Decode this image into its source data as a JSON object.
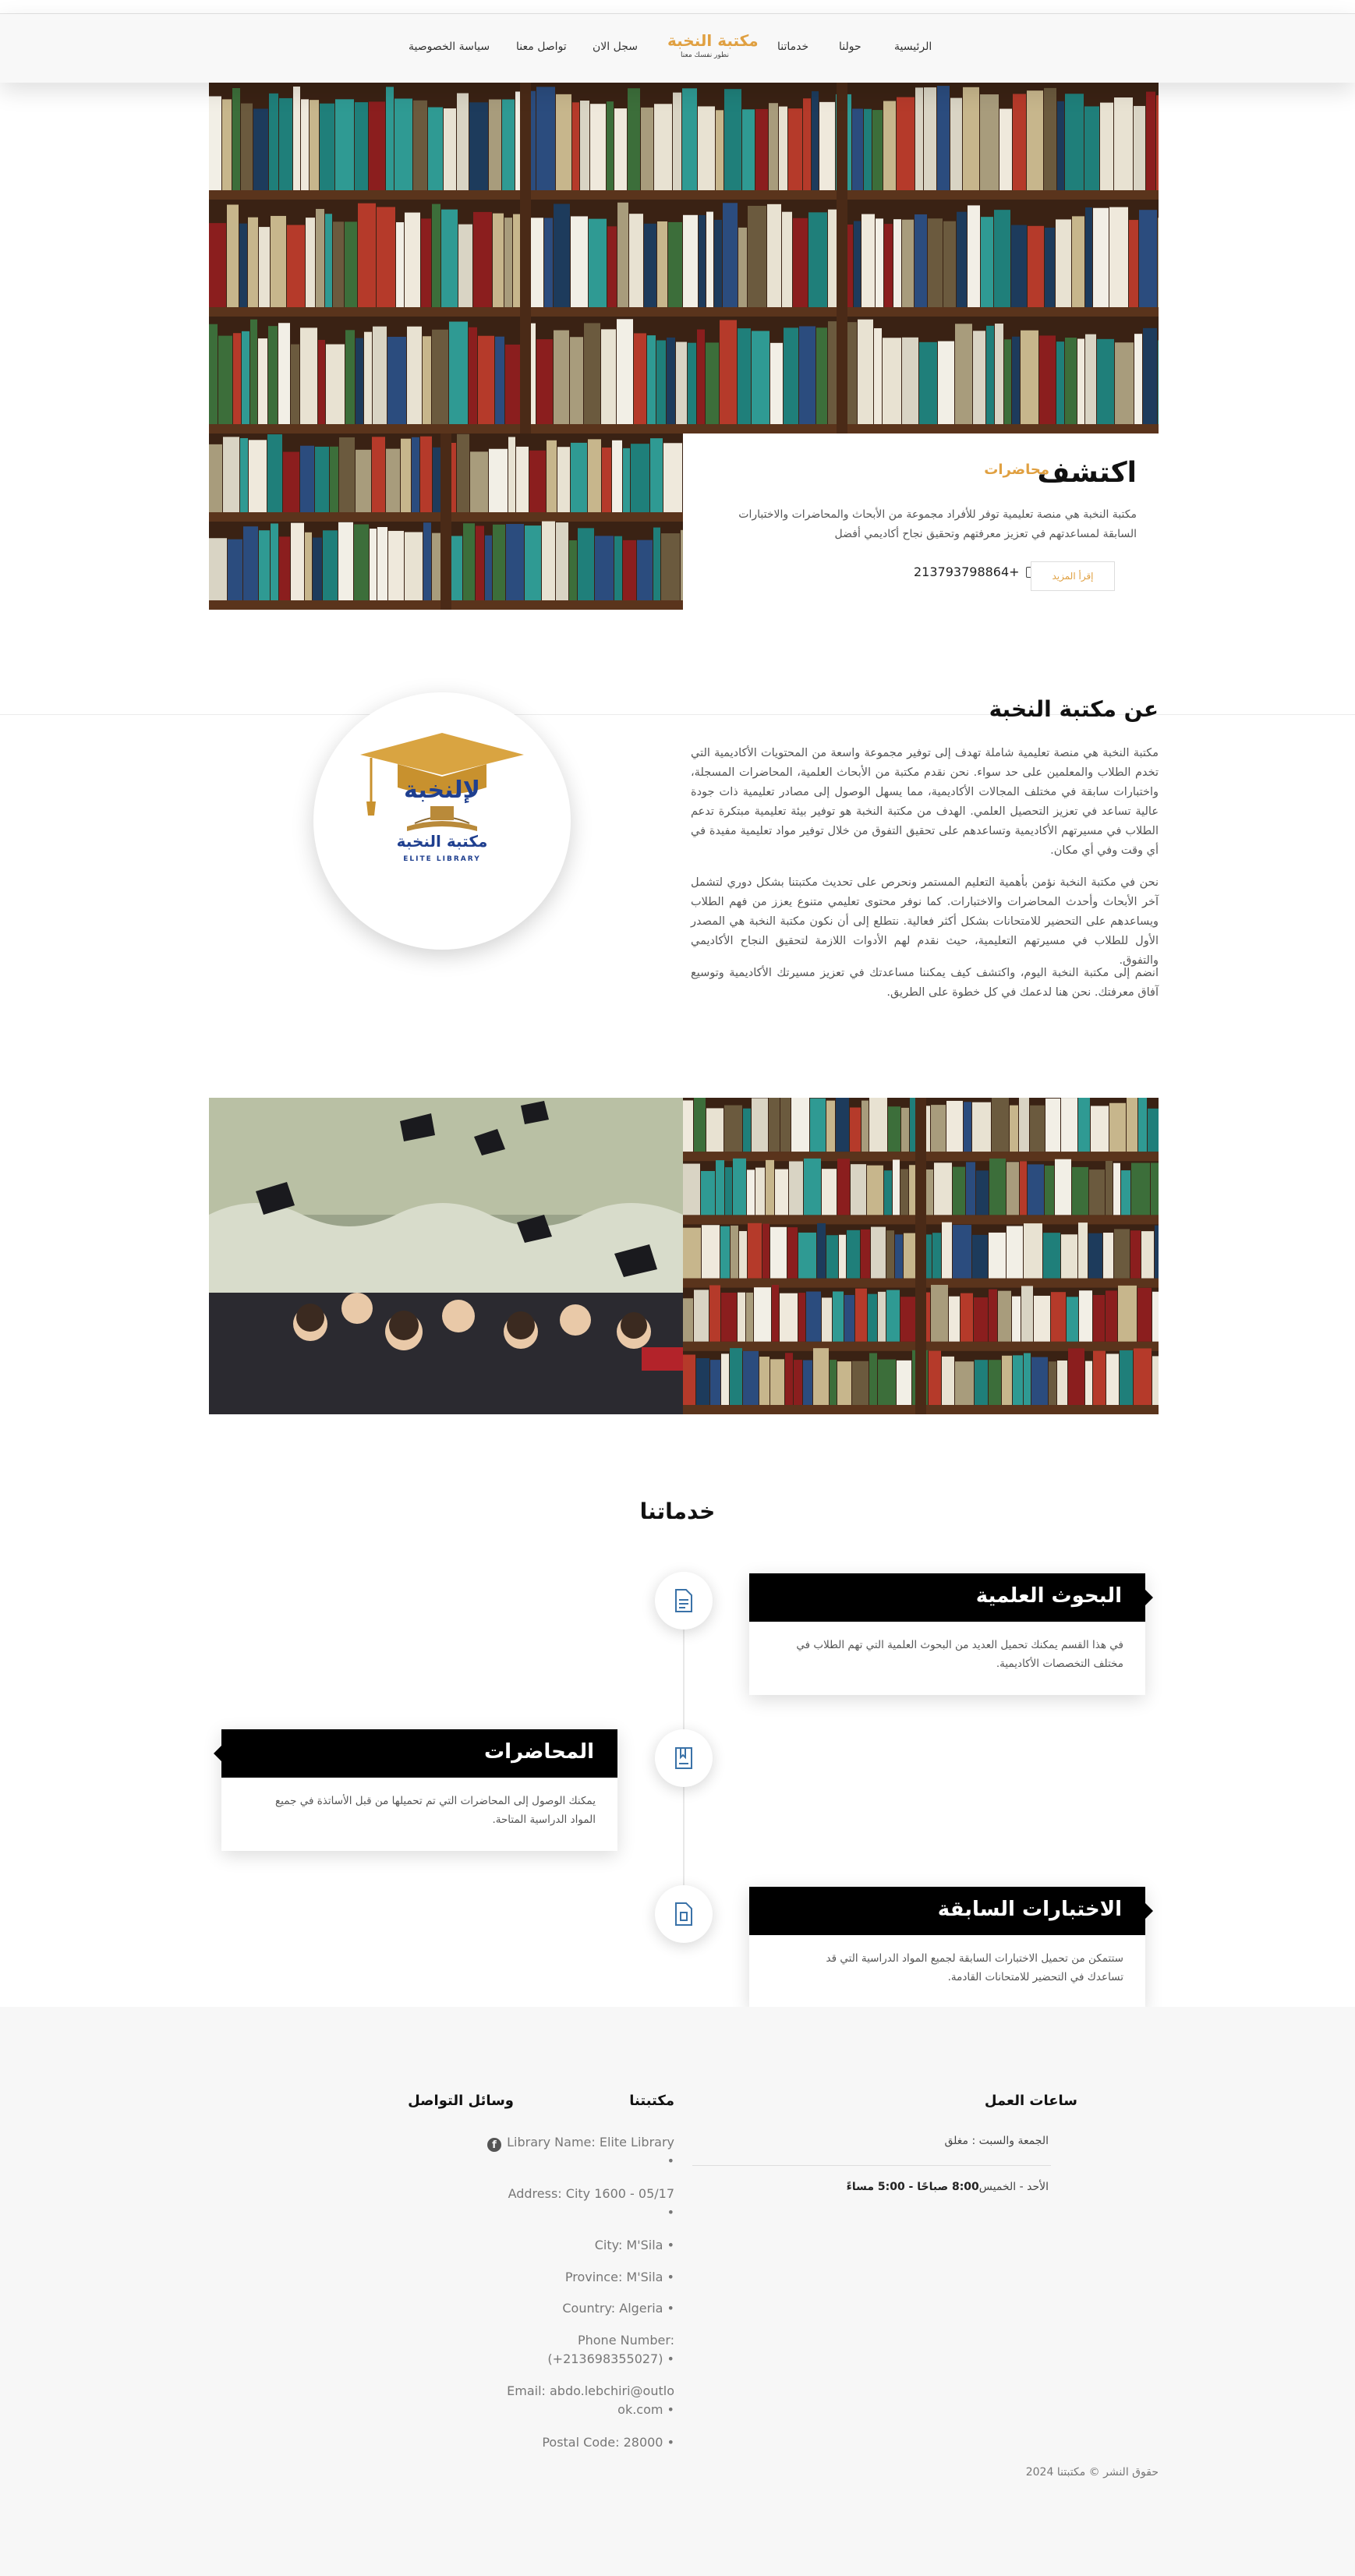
{
  "nav": {
    "home": "الرئيسية",
    "about": "حولنا",
    "services": "خدماتنا",
    "brand_title": "مكتبة النخبة",
    "brand_subtitle": "نطور نفسك معنا",
    "register": "سجل الان",
    "contact": "تواصل معنا",
    "privacy": "سياسة الخصوصية"
  },
  "hero": {
    "title": "اكتشف",
    "accent": "محاضرات",
    "description": "مكتبة النخبة هي منصة تعليمية توفر للأفراد مجموعة من الأبحاث والمحاضرات والاختبارات السابقة لمساعدتهم في تعزيز معرفتهم وتحقيق نجاح أكاديمي أفضل",
    "phone": "213793798864+",
    "read_more": "إقرأ المزيد"
  },
  "about": {
    "title": "عن مكتبة النخبة",
    "p1": "مكتبة النخبة هي منصة تعليمية شاملة تهدف إلى توفير مجموعة واسعة من المحتويات الأكاديمية التي تخدم الطلاب والمعلمين على حد سواء. نحن نقدم مكتبة من الأبحاث العلمية، المحاضرات المسجلة، واختبارات سابقة في مختلف المجالات الأكاديمية، مما يسهل الوصول إلى مصادر تعليمية ذات جودة عالية تساعد في تعزيز التحصيل العلمي. الهدف من مكتبة النخبة هو توفير بيئة تعليمية مبتكرة تدعم الطلاب في مسيرتهم الأكاديمية وتساعدهم على تحقيق التفوق من خلال توفير مواد تعليمية مفيدة في أي وقت وفي أي مكان.",
    "p2": "نحن في مكتبة النخبة نؤمن بأهمية التعليم المستمر ونحرص على تحديث مكتبتنا بشكل دوري لتشمل آخر الأبحاث وأحدث المحاضرات والاختبارات. كما نوفر محتوى تعليمي متنوع يعزز من فهم الطلاب ويساعدهم على التحضير للامتحانات بشكل أكثر فعالية. نتطلع إلى أن نكون مكتبة النخبة هي المصدر الأول للطلاب في مسيرتهم التعليمية، حيث نقدم لهم الأدوات اللازمة لتحقيق النجاح الأكاديمي والتفوق.",
    "p3": "انضم إلى مكتبة النخبة اليوم، واكتشف كيف يمكننا مساعدتك في تعزيز مسيرتك الأكاديمية وتوسيع آفاق معرفتك. نحن هنا لدعمك في كل خطوة على الطريق.",
    "logo_text_ar": "مكتبة النخبة",
    "logo_text_en": "ELITE LIBRARY"
  },
  "services": {
    "title": "خدماتنا",
    "items": [
      {
        "title": "البحوث العلمية",
        "desc": "في هذا القسم يمكنك تحميل العديد من البحوث العلمية التي تهم الطلاب في مختلف التخصصات الأكاديمية.",
        "icon": "document-icon"
      },
      {
        "title": "المحاضرات",
        "desc": "يمكنك الوصول إلى المحاضرات التي تم تحميلها من قبل الأساتذة في جميع المواد الدراسية المتاحة.",
        "icon": "book-icon"
      },
      {
        "title": "الاختبارات السابقة",
        "desc": "ستتمكن من تحميل الاختبارات السابقة لجميع المواد الدراسية التي قد تساعدك في التحضير للامتحانات القادمة.",
        "icon": "file-icon"
      }
    ]
  },
  "footer": {
    "hours_title": "ساعات العمل",
    "hours_1": "الجمعة والسبت : مغلق",
    "hours_2_days": "الأحد - الخميس",
    "hours_2_time": "8:00 صباحًا - 5:00 مساءً",
    "library_title": "مكتبتنا",
    "info": [
      "Library Name: Elite Library •",
      "Address: City 1600 - 05/17 •",
      "City: M'Sila •",
      "Province: M'Sila •",
      "Country: Algeria •",
      "Phone Number: (+213698355027) •",
      "Email: abdo.lebchiri@outlook.com •",
      "Postal Code: 28000 •"
    ],
    "social_title": "وسائل التواصل",
    "social_icon": "facebook-icon",
    "copyright": "حقوق النشر © مكتبتنا 2024"
  },
  "colors": {
    "accent": "#e0a041",
    "dark": "#000000",
    "footer_bg": "#f7f7f7",
    "logo_navy": "#1f3f8f"
  }
}
